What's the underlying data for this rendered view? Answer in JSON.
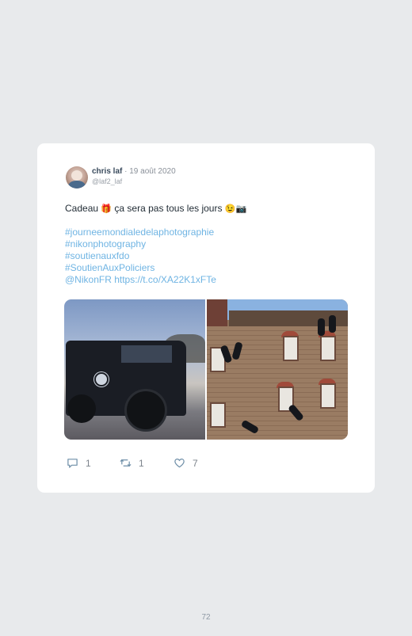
{
  "tweet": {
    "author_name": "chris laf",
    "separator": " · ",
    "date": "19 août 2020",
    "handle": "@laf2_laf",
    "text_prefix": "Cadeau ",
    "emoji_gift": "🎁",
    "text_middle": " ça sera pas tous les jours ",
    "emoji_wink": "😉",
    "emoji_camera": "📷",
    "hashtags": [
      "#journeemondialedelaphotographie",
      "#nikonphotography",
      "#soutienauxfdo",
      "#SoutienAuxPoliciers"
    ],
    "mention": "@NikonFR",
    "link": "https://t.co/XA22K1xFTe"
  },
  "actions": {
    "replies": "1",
    "retweets": "1",
    "likes": "7"
  },
  "icons": {
    "reply": "reply-icon",
    "retweet": "retweet-icon",
    "like": "heart-icon"
  },
  "colors": {
    "link": "#6fb4e3",
    "card": "#ffffff",
    "background": "#e8eaec"
  },
  "page": {
    "number": "72"
  }
}
